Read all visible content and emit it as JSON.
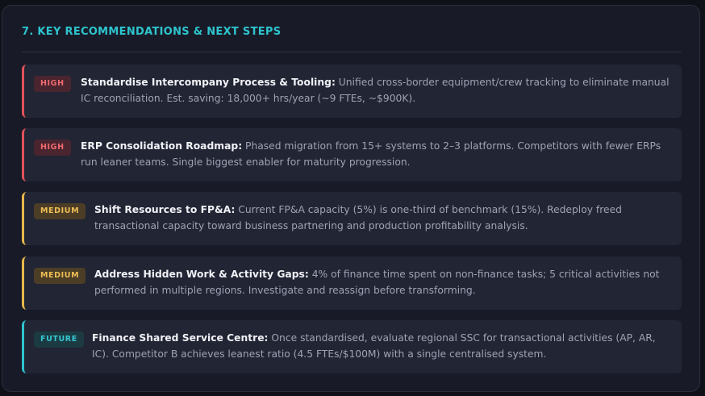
{
  "section": {
    "title": "7. KEY RECOMMENDATIONS & NEXT STEPS"
  },
  "recommendations": [
    {
      "priority": "HIGH",
      "title": "Standardise Intercompany Process & Tooling:",
      "description": " Unified cross-border equipment/crew tracking to eliminate manual IC reconciliation. Est. saving: 18,000+ hrs/year (~9 FTEs, ~$900K)."
    },
    {
      "priority": "HIGH",
      "title": "ERP Consolidation Roadmap:",
      "description": " Phased migration from 15+ systems to 2–3 platforms. Competitors with fewer ERPs run leaner teams. Single biggest enabler for maturity progression."
    },
    {
      "priority": "MEDIUM",
      "title": "Shift Resources to FP&A:",
      "description": " Current FP&A capacity (5%) is one-third of benchmark (15%). Redeploy freed transactional capacity toward business partnering and production profitability analysis."
    },
    {
      "priority": "MEDIUM",
      "title": "Address Hidden Work & Activity Gaps:",
      "description": " 4% of finance time spent on non-finance tasks; 5 critical activities not performed in multiple regions. Investigate and reassign before transforming."
    },
    {
      "priority": "FUTURE",
      "title": "Finance Shared Service Centre:",
      "description": " Once standardised, evaluate regional SSC for transactional activities (AP, AR, IC). Competitor B achieves leanest ratio (4.5 FTEs/$100M) with a single centralised system."
    }
  ],
  "colors": {
    "high": "#e0525a",
    "medium": "#e8b84a",
    "future": "#2ec4cf",
    "title": "#2ec4cf"
  }
}
